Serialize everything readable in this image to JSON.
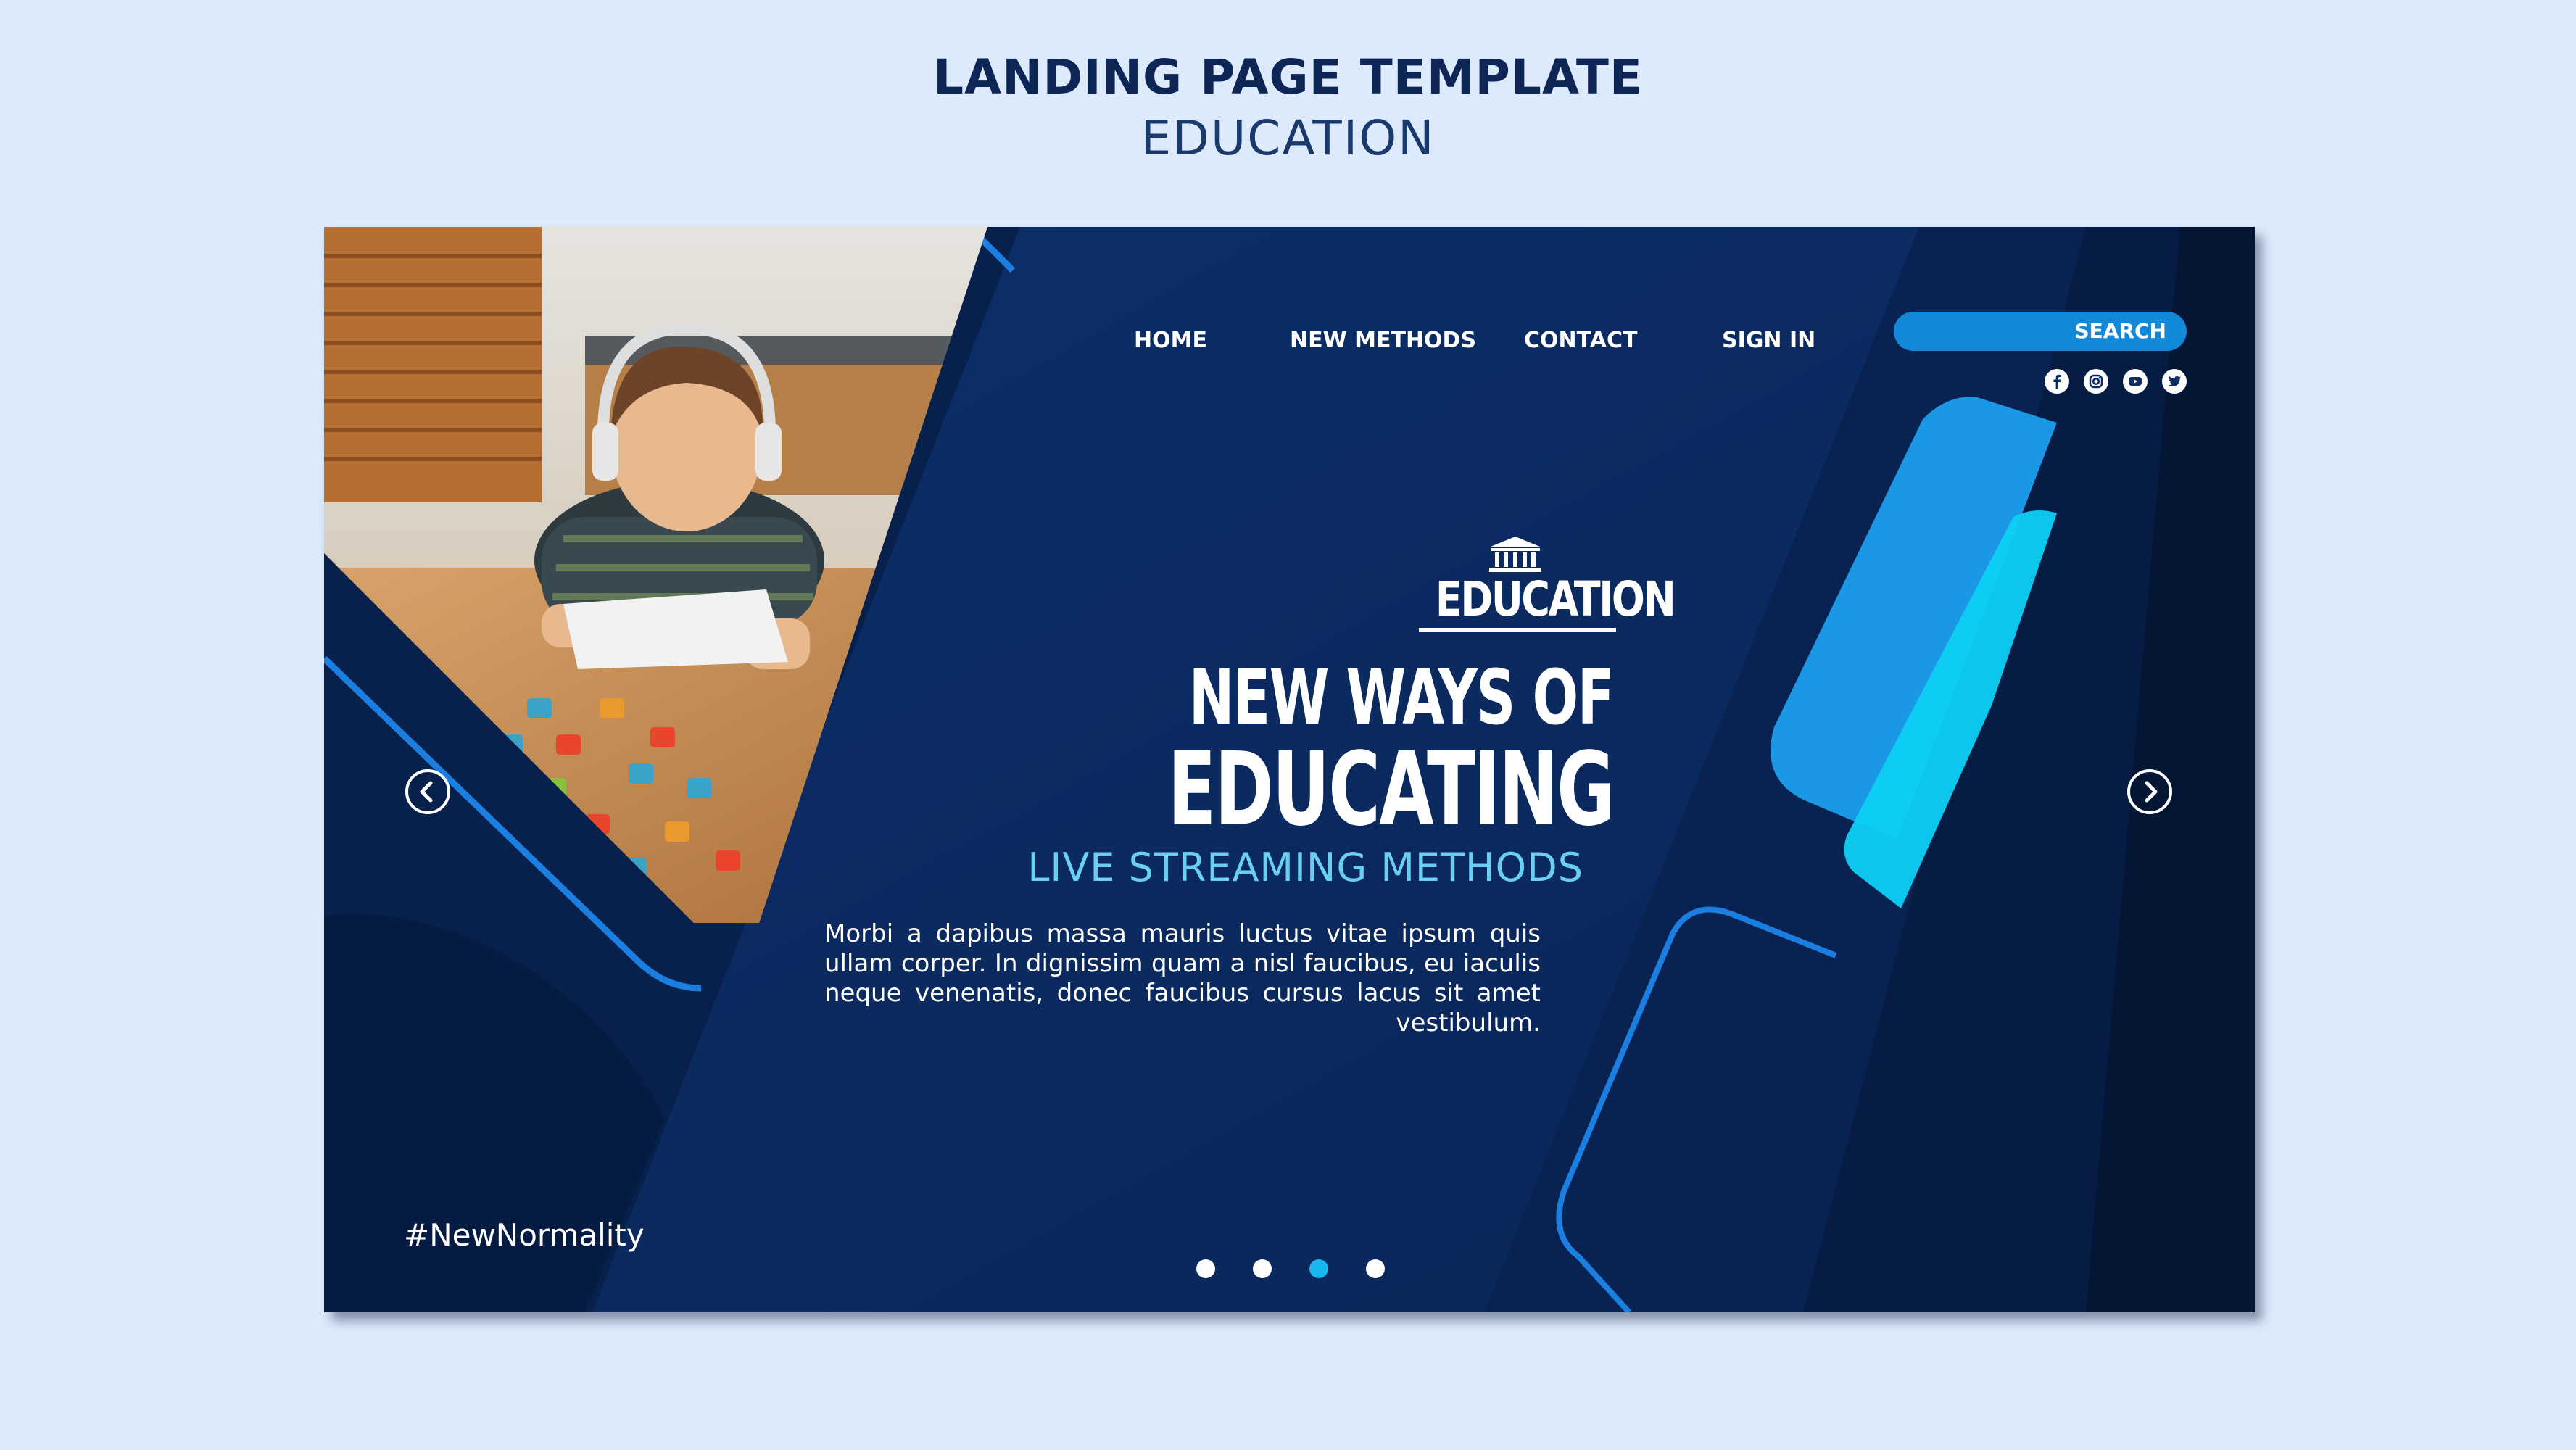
{
  "header": {
    "title": "LANDING PAGE TEMPLATE",
    "subtitle": "EDUCATION"
  },
  "nav": {
    "items": [
      "HOME",
      "NEW METHODS",
      "CONTACT",
      "SIGN IN"
    ],
    "search_label": "SEARCH"
  },
  "social": [
    "facebook-icon",
    "instagram-icon",
    "youtube-icon",
    "twitter-icon"
  ],
  "logo": {
    "text": "EDUCATION",
    "icon": "building-icon"
  },
  "hero": {
    "headline_line1": "NEW WAYS OF",
    "headline_line2": "EDUCATING",
    "subheading": "LIVE STREAMING METHODS",
    "body": "Morbi a dapibus massa mauris luctus vitae ipsum quis ullam corper. In dignissim quam a nisl faucibus, eu iaculis neque venenatis, donec faucibus cursus lacus sit amet vestibulum."
  },
  "hashtag": "#NewNormality",
  "carousel": {
    "slides": 4,
    "active_index": 2
  },
  "colors": {
    "page_bg": "#ddeafc",
    "banner_bg": "#0a2d63",
    "accent_blue": "#1188d8",
    "accent_cyan": "#69d0f4"
  }
}
